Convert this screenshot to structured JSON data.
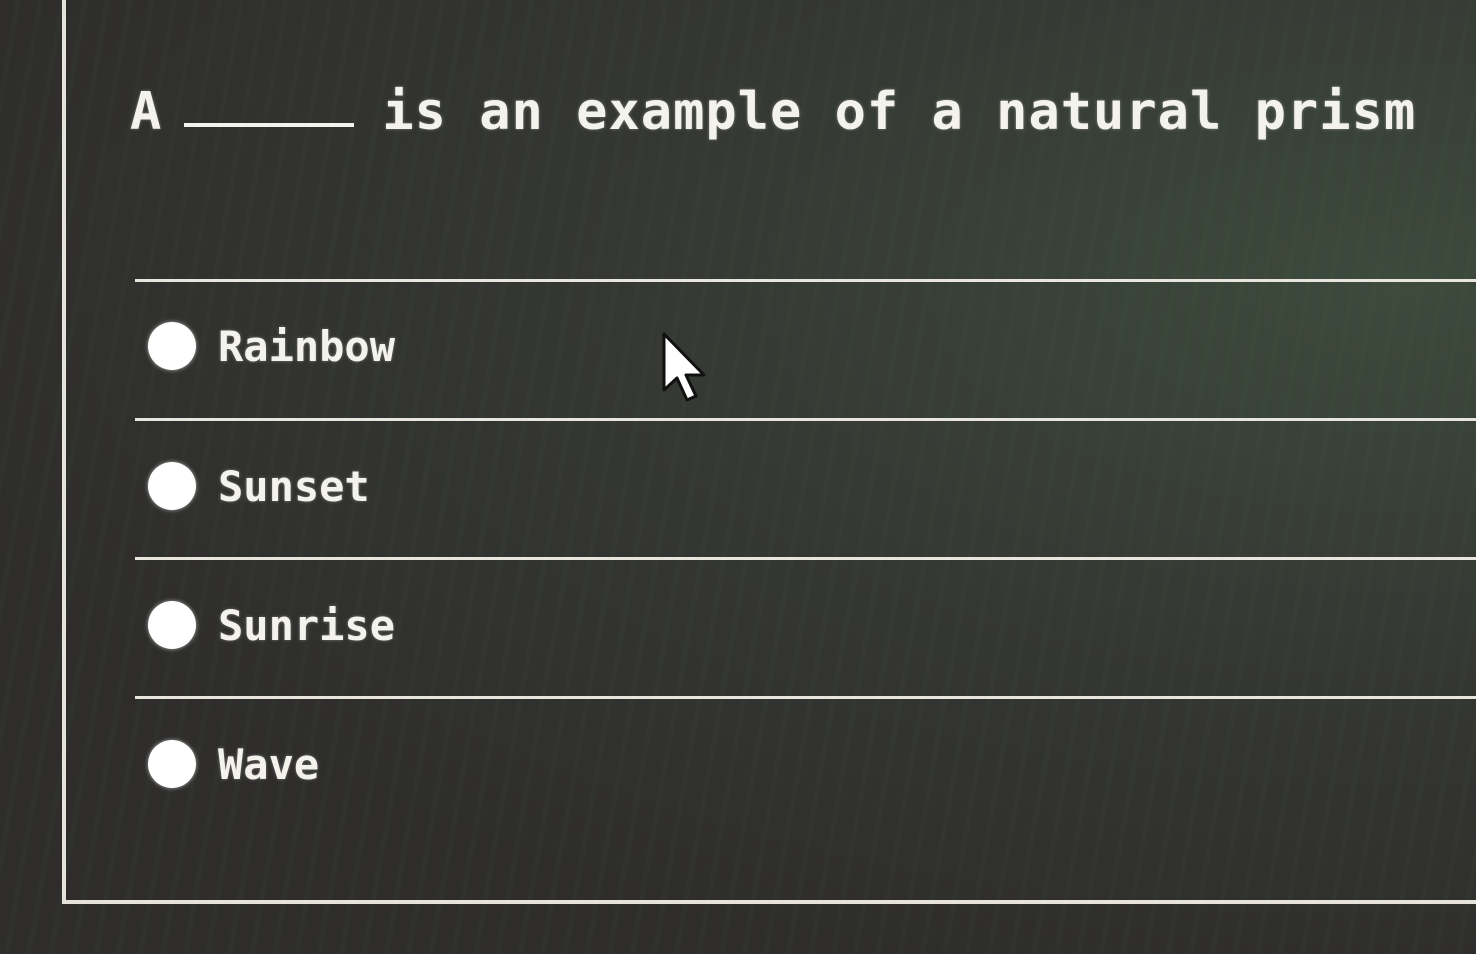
{
  "question": {
    "prefix": "A",
    "suffix": "is an example of a natural prism"
  },
  "options": [
    {
      "label": "Rainbow",
      "selected": false
    },
    {
      "label": "Sunset",
      "selected": false
    },
    {
      "label": "Sunrise",
      "selected": false
    },
    {
      "label": "Wave",
      "selected": false
    }
  ],
  "cursor_icon": "arrow-pointer-icon",
  "colors": {
    "background": "#2f2e2c",
    "text": "#f4f2ec",
    "lines": "#e8e5de",
    "radio_fill": "#ffffff"
  }
}
